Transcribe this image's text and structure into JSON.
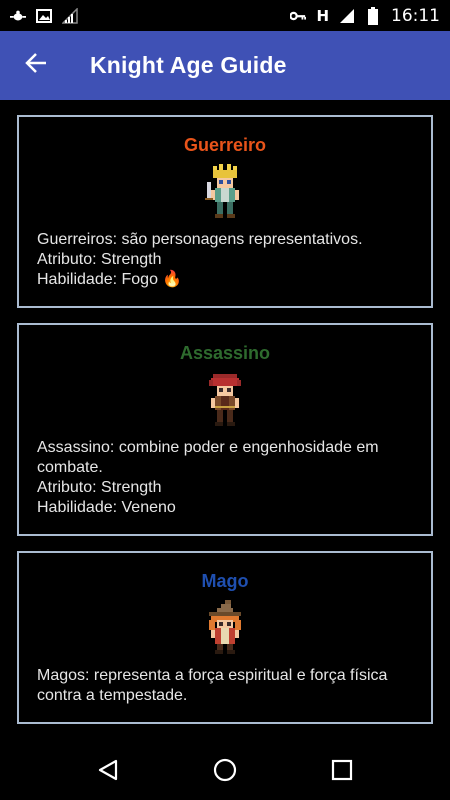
{
  "status_bar": {
    "time": "16:11",
    "network_letter": "H",
    "icons": [
      "bug-icon",
      "image-icon",
      "signal-empty-icon",
      "key-icon",
      "signal-icon",
      "battery-icon"
    ]
  },
  "app_bar": {
    "title": "Knight Age Guide",
    "back_icon": "arrow-left-icon",
    "color": "#3f51b5"
  },
  "cards": [
    {
      "title": "Guerreiro",
      "title_color": "#e8541a",
      "sprite": "warrior-sprite",
      "description": "Guerreiros: são personagens representativos.",
      "attribute": "Atributo: Strength",
      "ability": "Habilidade: Fogo 🔥"
    },
    {
      "title": "Assassino",
      "title_color": "#2e6b2e",
      "sprite": "assassin-sprite",
      "description": "Assassino: combine poder e engenhosidade em combate.",
      "attribute": "Atributo: Strength",
      "ability": "Habilidade: Veneno"
    },
    {
      "title": "Mago",
      "title_color": "#1f4fb0",
      "sprite": "mage-sprite",
      "description": "Magos: representa a força espiritual e força física contra a tempestade.",
      "attribute": "",
      "ability": ""
    }
  ],
  "nav_bar": {
    "back": "triangle-back-icon",
    "home": "circle-home-icon",
    "recents": "square-recents-icon"
  }
}
